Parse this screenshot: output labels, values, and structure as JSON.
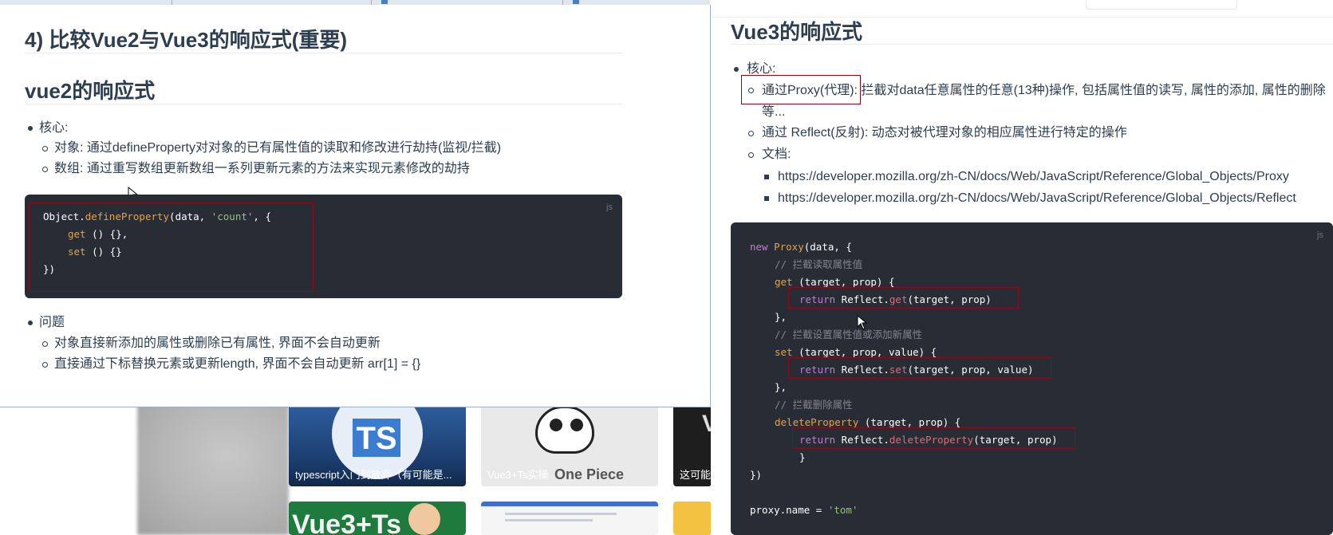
{
  "background_page": {
    "cards": [
      {
        "title": "typescript入门到放弃（有可能是...",
        "logo": "TS"
      },
      {
        "title": "Vue3+Ts实操",
        "extra": "One Piece"
      },
      {
        "title": "这可能"
      },
      {
        "title": "",
        "big": "Vue3+Ts"
      }
    ]
  },
  "left_doc": {
    "heading": "4) 比较Vue2与Vue3的响应式(重要)",
    "subheading": "vue2的响应式",
    "core_label": "核心:",
    "core_items": [
      "对象: 通过defineProperty对对象的已有属性值的读取和修改进行劫持(监视/拦截)",
      "数组: 通过重写数组更新数组一系列更新元素的方法来实现元素修改的劫持"
    ],
    "code_lang": "js",
    "code": {
      "l1_obj": "Object.",
      "l1_fn": "defineProperty",
      "l1_a": "(data, ",
      "l1_str": "'count'",
      "l1_b": ", {",
      "l2_kw": "get",
      "l2_rest": " () {},",
      "l3_kw": "set",
      "l3_rest": " () {}",
      "l4": "})"
    },
    "problem_label": "问题",
    "problem_items": [
      "对象直接新添加的属性或删除已有属性, 界面不会自动更新",
      "直接通过下标替换元素或更新length, 界面不会自动更新 arr[1] = {}"
    ]
  },
  "right_doc": {
    "heading": "Vue3的响应式",
    "core_label": "核心:",
    "item1_part1": "通过Proxy(代理): ",
    "item1_part2": "拦截对data任意属性的任意(13种)操作, 包括属性值的读写, 属性的添加, 属性的删除",
    "item1_cont": "等...",
    "item2": "通过 Reflect(反射): 动态对被代理对象的相应属性进行特定的操作",
    "docs_label": "文档:",
    "links": [
      "https://developer.mozilla.org/zh-CN/docs/Web/JavaScript/Reference/Global_Objects/Proxy",
      "https://developer.mozilla.org/zh-CN/docs/Web/JavaScript/Reference/Global_Objects/Reflect"
    ],
    "code_lang": "js",
    "code": {
      "l1_kw": "new",
      "l1_fn": "Proxy",
      "l1_rest": "(data, {",
      "l2_cm": "// 拦截读取属性值",
      "l3_fn": "get",
      "l3_rest": " (target, prop) {",
      "l4_kw": "return",
      "l4_a": " Reflect.",
      "l4_fn": "get",
      "l4_b": "(target, prop)",
      "l5": "},",
      "l6_cm": "// 拦截设置属性值或添加新属性",
      "l7_fn": "set",
      "l7_rest": " (target, prop, value) {",
      "l8_kw": "return",
      "l8_a": " Reflect.",
      "l8_fn": "set",
      "l8_b": "(target, prop, value)",
      "l9": "},",
      "l10_cm": "// 拦截删除属性",
      "l11_fn": "deleteProperty",
      "l11_rest": " (target, prop) {",
      "l12_kw": "return",
      "l12_a": " Reflect.",
      "l12_fn": "deleteProperty",
      "l12_b": "(target, prop)",
      "l13": "}",
      "l14": "})",
      "l15_a": "proxy.name = ",
      "l15_str": "'tom'"
    }
  },
  "colors": {
    "annotation_box": "#8b0a18",
    "code_bg": "#282c34",
    "text": "#2c3e50",
    "keyword": "#c678dd",
    "function": "#e5a24b",
    "string": "#98c379",
    "comment": "#7f848e"
  }
}
